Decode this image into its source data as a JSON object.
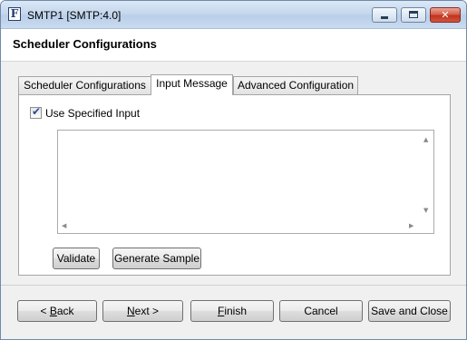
{
  "window": {
    "app_icon_letter": "F",
    "title": "SMTP1 [SMTP:4.0]",
    "controls": {
      "minimize_icon": "minimize-icon",
      "maximize_icon": "maximize-icon",
      "close_icon": "close-icon",
      "close_glyph": "✕"
    }
  },
  "header": {
    "title": "Scheduler Configurations"
  },
  "tabs": [
    {
      "label": "Scheduler Configurations",
      "active": false
    },
    {
      "label": "Input Message",
      "active": true
    },
    {
      "label": "Advanced Configuration",
      "active": false
    }
  ],
  "panel": {
    "use_specified_input": {
      "label": "Use Specified Input",
      "checked": true,
      "check_glyph": "✔"
    },
    "input_text": "",
    "scroll_arrows": {
      "up": "▲",
      "down": "▼",
      "left": "◀",
      "right": "▶"
    },
    "buttons": {
      "validate": "Validate",
      "generate_sample": "Generate Sample"
    }
  },
  "footer": {
    "back": {
      "prefix": "< ",
      "mnemonic": "B",
      "rest": "ack"
    },
    "next": {
      "mnemonic": "N",
      "rest": "ext >"
    },
    "finish": {
      "mnemonic": "F",
      "rest": "inish"
    },
    "cancel": "Cancel",
    "save_and_close": "Save and Close"
  },
  "colors": {
    "titlebar": "#c6d8ee",
    "close_button": "#c2331c",
    "window_bg": "#f0f0f0"
  }
}
